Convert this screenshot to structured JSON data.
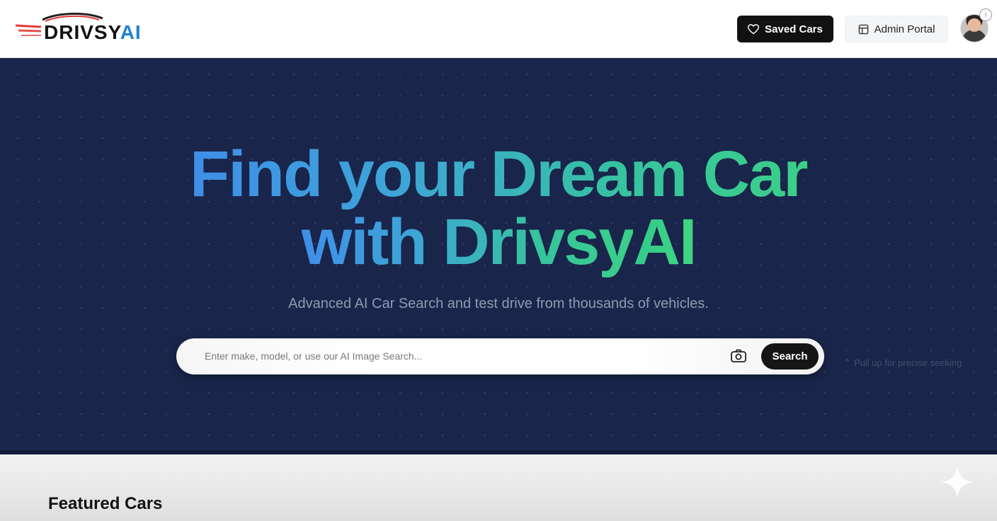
{
  "header": {
    "logo": {
      "text_main": "DRIVSY",
      "text_accent": "AI"
    },
    "saved_cars_label": "Saved Cars",
    "admin_portal_label": "Admin Portal",
    "info_label": "i"
  },
  "hero": {
    "headline_line1": "Find your Dream Car",
    "headline_line2_a": "with Drivsy",
    "headline_line2_b": "AI",
    "subtitle": "Advanced AI Car Search and test drive from thousands of vehicles.",
    "search": {
      "placeholder": "Enter make, model, or use our AI Image Search...",
      "button_label": "Search"
    },
    "hint_text": "Pull up for precise seeking"
  },
  "featured": {
    "title": "Featured Cars"
  },
  "colors": {
    "hero_bg": "#19254a",
    "gradient_start": "#3f8ee8",
    "gradient_end": "#3ccf88",
    "logo_accent": "#1e7fd6"
  }
}
